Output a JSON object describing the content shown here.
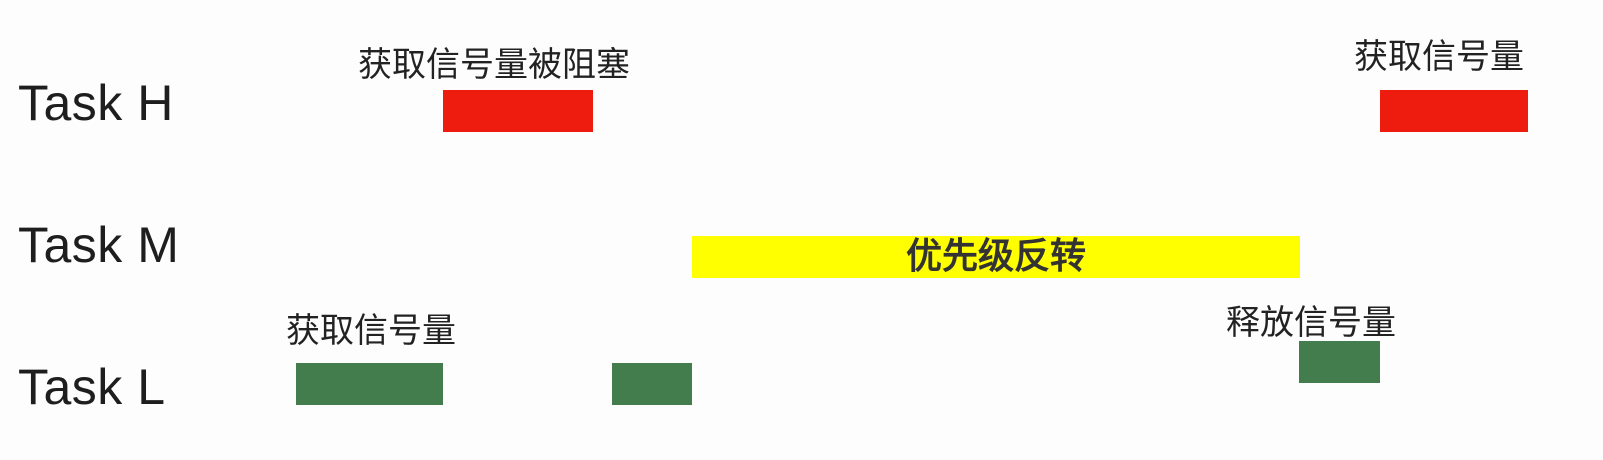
{
  "rows": {
    "h": {
      "label": "Task H"
    },
    "m": {
      "label": "Task M"
    },
    "l": {
      "label": "Task L"
    }
  },
  "annotations": {
    "h_blocked": "获取信号量被阻塞",
    "h_acquire": "获取信号量",
    "m_inversion": "优先级反转",
    "l_acquire": "获取信号量",
    "l_release": "释放信号量"
  },
  "colors": {
    "task_h": "#ee1c0f",
    "task_m": "#ffff00",
    "task_l": "#437c4d"
  }
}
